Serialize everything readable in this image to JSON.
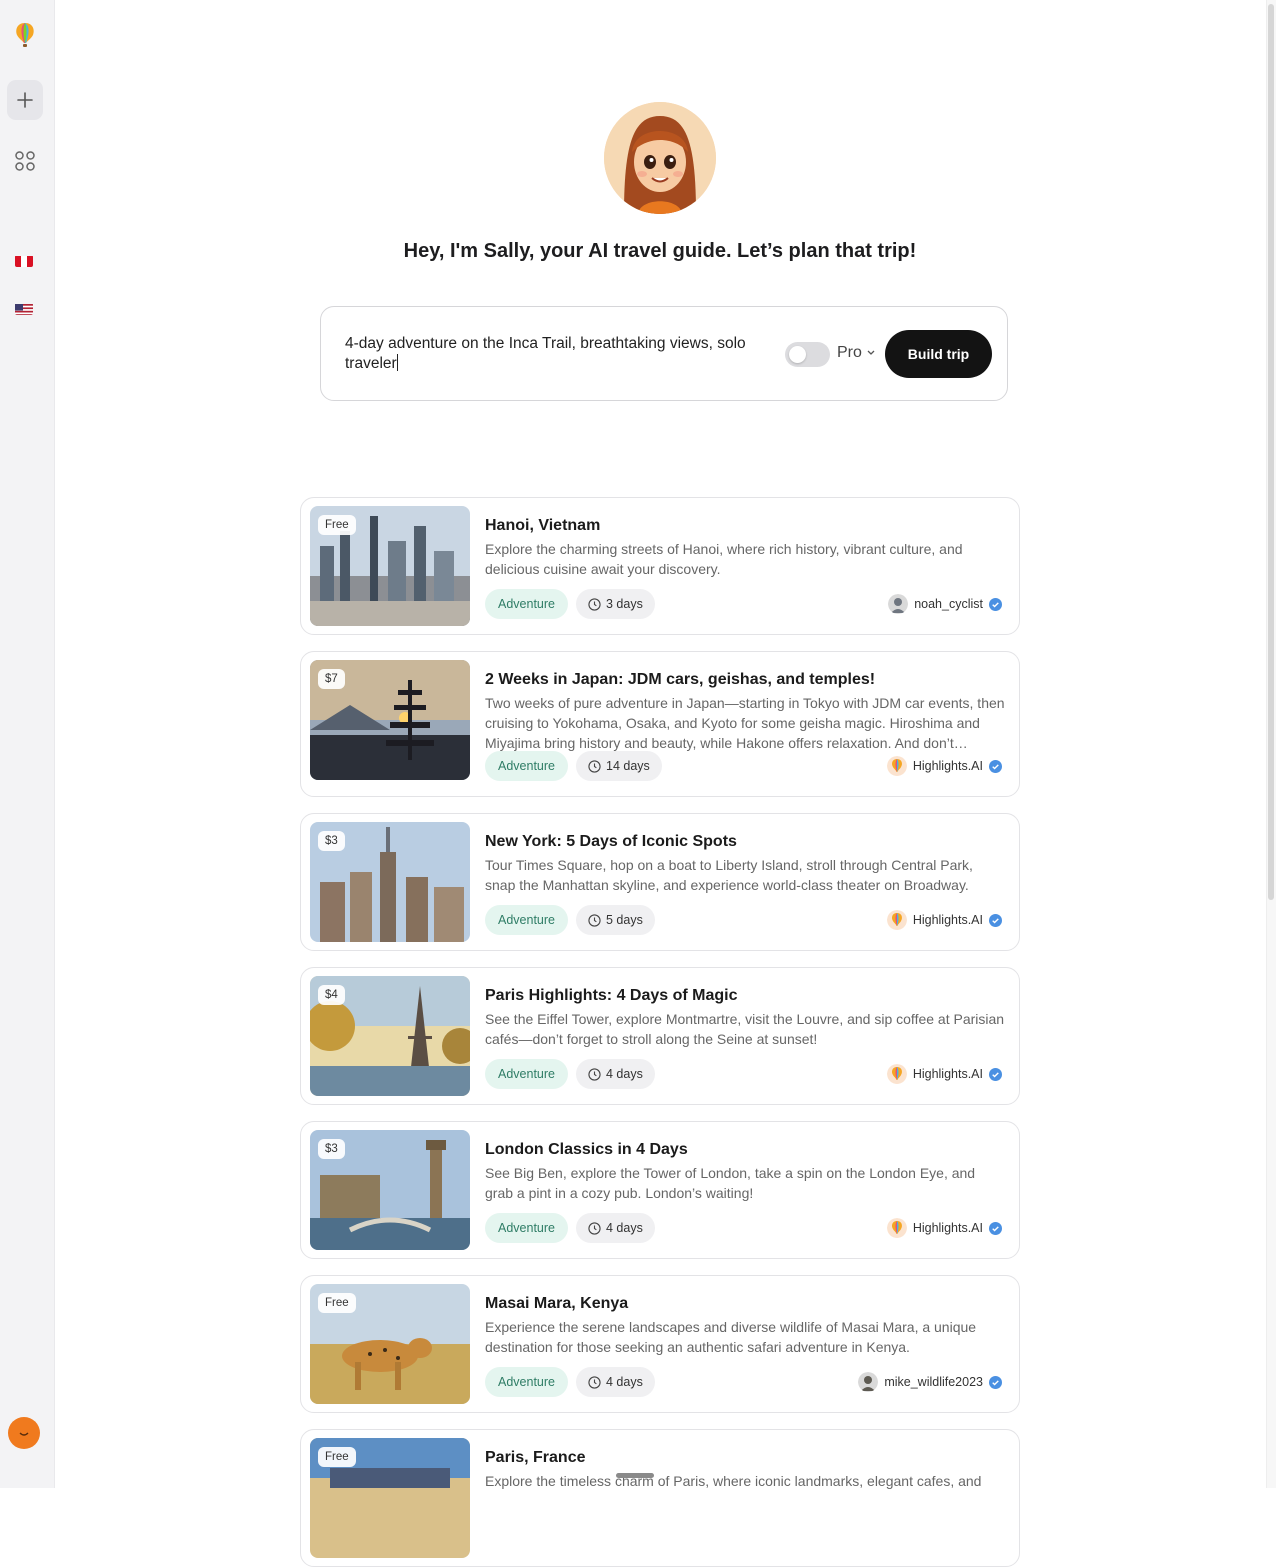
{
  "sidebar": {
    "logo_icon": "hot-air-balloon-icon",
    "new_icon": "plus-icon",
    "apps_icon": "grid-icon",
    "flags": [
      "peru-flag",
      "usa-flag"
    ],
    "profile_icon": "orange-avatar"
  },
  "hero": {
    "greeting": "Hey, I'm Sally, your AI travel guide. Let’s plan that trip!"
  },
  "prompt": {
    "value": "4-day adventure on the Inca Trail, breathtaking views, solo traveler",
    "pro_label": "Pro",
    "pro_enabled": false,
    "build_label": "Build trip"
  },
  "trips": [
    {
      "price": "Free",
      "title": "Hanoi, Vietnam",
      "description": "Explore the charming streets of Hanoi, where rich history, vibrant culture, and delicious cuisine await your discovery.",
      "tag": "Adventure",
      "duration": "3 days",
      "author": "noah_cyclist",
      "image": "city"
    },
    {
      "price": "$7",
      "title": "2 Weeks in Japan: JDM cars, geishas, and temples!",
      "description": "Two weeks of pure adventure in Japan—starting in Tokyo with JDM car events, then cruising to Yokohama, Osaka, and Kyoto for some geisha magic. Hiroshima and Miyajima bring history and beauty, while Hakone offers relaxation. And don’t…",
      "tag": "Adventure",
      "duration": "14 days",
      "author": "Highlights.AI",
      "image": "pagoda"
    },
    {
      "price": "$3",
      "title": "New York: 5 Days of Iconic Spots",
      "description": "Tour Times Square, hop on a boat to Liberty Island, stroll through Central Park, snap the Manhattan skyline, and experience world-class theater on Broadway.",
      "tag": "Adventure",
      "duration": "5 days",
      "author": "Highlights.AI",
      "image": "skyline"
    },
    {
      "price": "$4",
      "title": "Paris Highlights: 4 Days of Magic",
      "description": "See the Eiffel Tower, explore Montmartre, visit the Louvre, and sip coffee at Parisian cafés—don’t forget to stroll along the Seine at sunset!",
      "tag": "Adventure",
      "duration": "4 days",
      "author": "Highlights.AI",
      "image": "eiffel"
    },
    {
      "price": "$3",
      "title": "London Classics in 4 Days",
      "description": "See Big Ben, explore the Tower of London, take a spin on the London Eye, and grab a pint in a cozy pub. London’s waiting!",
      "tag": "Adventure",
      "duration": "4 days",
      "author": "Highlights.AI",
      "image": "london"
    },
    {
      "price": "Free",
      "title": "Masai Mara, Kenya",
      "description": "Experience the serene landscapes and diverse wildlife of Masai Mara, a unique destination for those seeking an authentic safari adventure in Kenya.",
      "tag": "Adventure",
      "duration": "4 days",
      "author": "mike_wildlife2023",
      "image": "leopard"
    },
    {
      "price": "Free",
      "title": "Paris, France",
      "description": "Explore the timeless charm of Paris, where iconic landmarks, elegant cafes, and",
      "tag": "",
      "duration": "",
      "author": "",
      "image": "paris"
    }
  ],
  "colors": {
    "accent_dark": "#131313",
    "tag_green_bg": "#e4f5ef",
    "tag_green_text": "#2f7d66",
    "verified_blue": "#4a90e2",
    "sidebar_bg": "#f3f3f5"
  }
}
